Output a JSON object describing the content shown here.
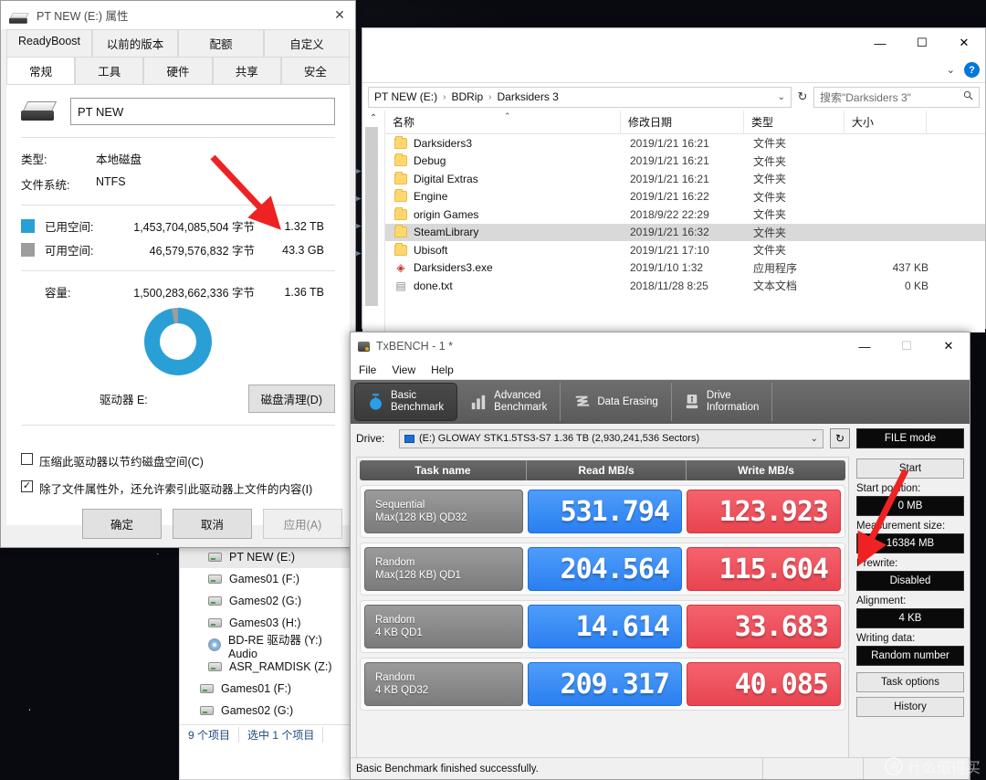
{
  "properties_dialog": {
    "title": "PT NEW (E:) 属性",
    "close_label": "✕",
    "tabs_row1": [
      "ReadyBoost",
      "以前的版本",
      "配额",
      "自定义"
    ],
    "tabs_row2": [
      "常规",
      "工具",
      "硬件",
      "共享",
      "安全"
    ],
    "active_tab": "常规",
    "volume_name": "PT NEW",
    "type_label": "类型:",
    "type_value": "本地磁盘",
    "fs_label": "文件系统:",
    "fs_value": "NTFS",
    "used_label": "已用空间:",
    "used_bytes": "1,453,704,085,504 字节",
    "used_human": "1.32 TB",
    "used_color": "#2a9fd6",
    "free_label": "可用空间:",
    "free_bytes": "46,579,576,832 字节",
    "free_human": "43.3 GB",
    "free_color": "#9d9d9d",
    "capacity_label": "容量:",
    "capacity_bytes": "1,500,283,662,336 字节",
    "capacity_human": "1.36 TB",
    "drive_caption": "驱动器 E:",
    "cleanup_button": "磁盘清理(D)",
    "checkbox_compress": "压缩此驱动器以节约磁盘空间(C)",
    "checkbox_compress_checked": false,
    "checkbox_index": "除了文件属性外，还允许索引此驱动器上文件的内容(I)",
    "checkbox_index_checked": true,
    "checkbox_mark": "✓",
    "ok_button": "确定",
    "cancel_button": "取消",
    "apply_button": "应用(A)"
  },
  "explorer": {
    "minimize": "—",
    "maximize": "☐",
    "close": "✕",
    "chevron": "⌄",
    "help": "?",
    "breadcrumbs": [
      "PT NEW (E:)",
      "BDRip",
      "Darksiders 3"
    ],
    "breadcrumb_sep": "›",
    "breadcrumb_caret": "⌄",
    "refresh_icon": "↻",
    "search_placeholder": "搜索\"Darksiders 3\"",
    "search_icon": "🔍",
    "collapse_caret": "⌃",
    "columns": [
      "名称",
      "修改日期",
      "类型",
      "大小"
    ],
    "sort_caret": "⌃",
    "files": [
      {
        "name": "Darksiders3",
        "icon": "folder",
        "date": "2019/1/21 16:21",
        "type": "文件夹",
        "size": "",
        "selected": false
      },
      {
        "name": "Debug",
        "icon": "folder",
        "date": "2019/1/21 16:21",
        "type": "文件夹",
        "size": "",
        "selected": false
      },
      {
        "name": "Digital Extras",
        "icon": "folder",
        "date": "2019/1/21 16:21",
        "type": "文件夹",
        "size": "",
        "selected": false
      },
      {
        "name": "Engine",
        "icon": "folder",
        "date": "2019/1/21 16:22",
        "type": "文件夹",
        "size": "",
        "selected": false
      },
      {
        "name": "origin Games",
        "icon": "folder",
        "date": "2018/9/22 22:29",
        "type": "文件夹",
        "size": "",
        "selected": false
      },
      {
        "name": "SteamLibrary",
        "icon": "folder",
        "date": "2019/1/21 16:32",
        "type": "文件夹",
        "size": "",
        "selected": true
      },
      {
        "name": "Ubisoft",
        "icon": "folder",
        "date": "2019/1/21 17:10",
        "type": "文件夹",
        "size": "",
        "selected": false
      },
      {
        "name": "Darksiders3.exe",
        "icon": "exe",
        "date": "2019/1/10 1:32",
        "type": "应用程序",
        "size": "437 KB",
        "selected": false
      },
      {
        "name": "done.txt",
        "icon": "txt",
        "date": "2018/11/28 8:25",
        "type": "文本文档",
        "size": "0 KB",
        "selected": false
      }
    ]
  },
  "nav_tree": {
    "items": [
      {
        "label": "PT NEW (E:)",
        "icon": "hdd",
        "selected": true,
        "level": 1
      },
      {
        "label": "Games01 (F:)",
        "icon": "hdd",
        "selected": false,
        "level": 1
      },
      {
        "label": "Games02 (G:)",
        "icon": "hdd",
        "selected": false,
        "level": 1
      },
      {
        "label": "Games03 (H:)",
        "icon": "hdd",
        "selected": false,
        "level": 1
      },
      {
        "label": "BD-RE 驱动器 (Y:) Audio",
        "icon": "cd",
        "selected": false,
        "level": 1
      },
      {
        "label": "ASR_RAMDISK (Z:)",
        "icon": "hdd",
        "selected": false,
        "level": 1
      },
      {
        "label": "Games01 (F:)",
        "icon": "hdd",
        "selected": false,
        "level": 0
      },
      {
        "label": "Games02 (G:)",
        "icon": "hdd",
        "selected": false,
        "level": 0
      }
    ],
    "status_count": "9 个项目",
    "status_selected": "选中 1 个项目"
  },
  "txbench": {
    "title": "TxBENCH - 1 *",
    "minimize": "—",
    "maximize": "☐",
    "close": "✕",
    "menu": [
      "File",
      "View",
      "Help"
    ],
    "tabs": [
      {
        "label_line1": "Basic",
        "label_line2": "Benchmark",
        "icon": "gauge-icon",
        "active": true
      },
      {
        "label_line1": "Advanced",
        "label_line2": "Benchmark",
        "icon": "bar-chart-icon",
        "active": false
      },
      {
        "label_line1": "Data Erasing",
        "label_line2": "",
        "icon": "erase-icon",
        "active": false
      },
      {
        "label_line1": "Drive",
        "label_line2": "Information",
        "icon": "info-icon",
        "active": false
      }
    ],
    "drive_label": "Drive:",
    "drive_value": "(E:) GLOWAY STK1.5TS3-S7  1.36 TB (2,930,241,536 Sectors)",
    "drive_caret": "⌄",
    "refresh_icon": "↻",
    "file_mode": "FILE mode",
    "columns": [
      "Task name",
      "Read MB/s",
      "Write MB/s"
    ],
    "rows": [
      {
        "task_line1": "Sequential",
        "task_line2": "Max(128 KB) QD32",
        "read": "531.794",
        "write": "123.923"
      },
      {
        "task_line1": "Random",
        "task_line2": "Max(128 KB) QD1",
        "read": "204.564",
        "write": "115.604"
      },
      {
        "task_line1": "Random",
        "task_line2": "4 KB QD1",
        "read": "14.614",
        "write": "33.683"
      },
      {
        "task_line1": "Random",
        "task_line2": "4 KB QD32",
        "read": "209.317",
        "write": "40.085"
      }
    ],
    "read_color": "#2a7ff0",
    "write_color": "#e8444f",
    "side": {
      "start_button": "Start",
      "start_position_label": "Start position:",
      "start_position_value": "0 MB",
      "measurement_label": "Measurement size:",
      "measurement_value": "16384 MB",
      "prewrite_label": "Prewrite:",
      "prewrite_value": "Disabled",
      "alignment_label": "Alignment:",
      "alignment_value": "4 KB",
      "writing_label": "Writing data:",
      "writing_value": "Random number",
      "task_options_button": "Task options",
      "history_button": "History"
    },
    "status_text": "Basic Benchmark finished successfully."
  },
  "watermark": {
    "mark": "值",
    "text": "什么值得买"
  },
  "annotations": {
    "arrow_color": "#ee2222"
  }
}
